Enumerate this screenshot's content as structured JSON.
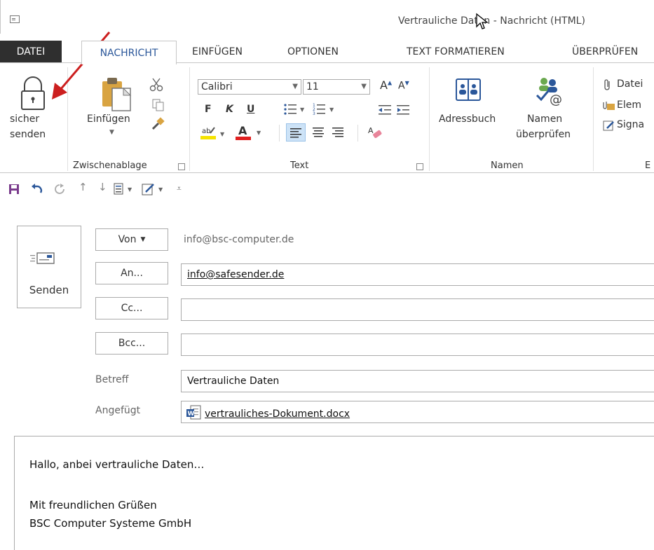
{
  "window": {
    "title": "Vertrauliche Daten - Nachricht (HTML)"
  },
  "tabs": {
    "file": "DATEI",
    "items": [
      "NACHRICHT",
      "EINFÜGEN",
      "OPTIONEN",
      "TEXT FORMATIEREN",
      "ÜBERPRÜFEN"
    ]
  },
  "ribbon": {
    "secure_send": {
      "line1": "sicher",
      "line2": "senden"
    },
    "clipboard": {
      "paste_label": "Einfügen",
      "group_label": "Zwischenablage"
    },
    "text": {
      "font": "Calibri",
      "size": "11",
      "bold": "F",
      "italic": "K",
      "underline": "U",
      "group_label": "Text"
    },
    "names": {
      "address_book": "Adressbuch",
      "check_names_1": "Namen",
      "check_names_2": "überprüfen",
      "group_label": "Namen"
    },
    "include": {
      "attach_file": "Datei",
      "attach_item": "Elem",
      "signature": "Signa",
      "group_label": "E"
    }
  },
  "message": {
    "send_label": "Senden",
    "from_label": "Von",
    "from_value": "info@bsc-computer.de",
    "to_label": "An...",
    "to_value": "info@safesender.de",
    "cc_label": "Cc...",
    "bcc_label": "Bcc...",
    "subject_label": "Betreff",
    "subject_value": "Vertrauliche Daten",
    "attached_label": "Angefügt",
    "attachment_name": "vertrauliches-Dokument.docx"
  },
  "body": {
    "greeting": "Hallo, anbei vertrauliche Daten…",
    "closing": "Mit freundlichen Grüßen",
    "company": "BSC Computer Systeme GmbH"
  },
  "colors": {
    "accent": "#2b579a",
    "file_tab": "#2f2f2f",
    "annotation_arrow": "#cc1f1f",
    "save_icon": "#7a3b8c"
  }
}
